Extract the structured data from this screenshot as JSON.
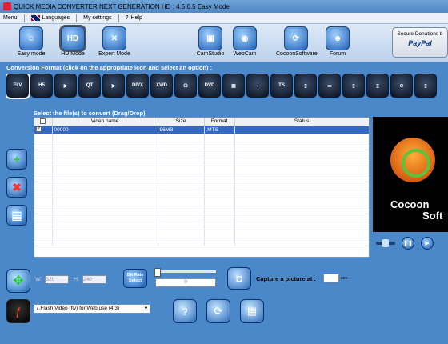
{
  "window": {
    "title": "QUICK MEDIA CONVERTER NEXT GENERATION HD : 4.5.0.5 Easy Mode"
  },
  "menu": {
    "items": [
      "Menu",
      "Languages",
      "My settings",
      "Help"
    ]
  },
  "toolbar": {
    "easy_mode": "Easy mode",
    "hd_mode": "HD Mode",
    "hd_icon_text": "HD",
    "expert_mode": "Expert Mode",
    "camstudio": "CamStudio",
    "webcam": "WebCam",
    "cocoonsoftware": "CocoonSoftware",
    "forum": "Forum",
    "donate_line": "Secure Donations b",
    "donate_brand": "PayPal"
  },
  "conversion_label": "Conversion Format (click on the appropriate icon and select an option) :",
  "formats": [
    "FLV",
    "H5",
    "▶",
    "QT",
    "▶",
    "DIVX",
    "XVID",
    "☊",
    "DVD",
    "▤",
    "♪",
    "TS",
    "▯",
    "▭",
    "▯",
    "▯",
    "⊘",
    "▯"
  ],
  "select_label": "Select  the  file(s) to convert (Drag/Drop)",
  "table": {
    "columns": [
      "",
      "Video name",
      "Size",
      "Format",
      "Status"
    ],
    "rows": [
      {
        "checked": true,
        "name": "00000",
        "size": "96MB",
        "format": ".MTS",
        "status": ""
      }
    ]
  },
  "preview": {
    "brand_line1": "Cocoon",
    "brand_line2": "Soft"
  },
  "controls": {
    "width_label": "W:",
    "width_value": "320",
    "height_label": "H:",
    "height_value": "240",
    "bitrate_label": "Bit Rate Select",
    "bitrate_value": "0",
    "capture_label": "Capture a picture at :",
    "capture_unit": "sec",
    "profile": "7.Flash Video (flv) for Web use (4:3)"
  }
}
